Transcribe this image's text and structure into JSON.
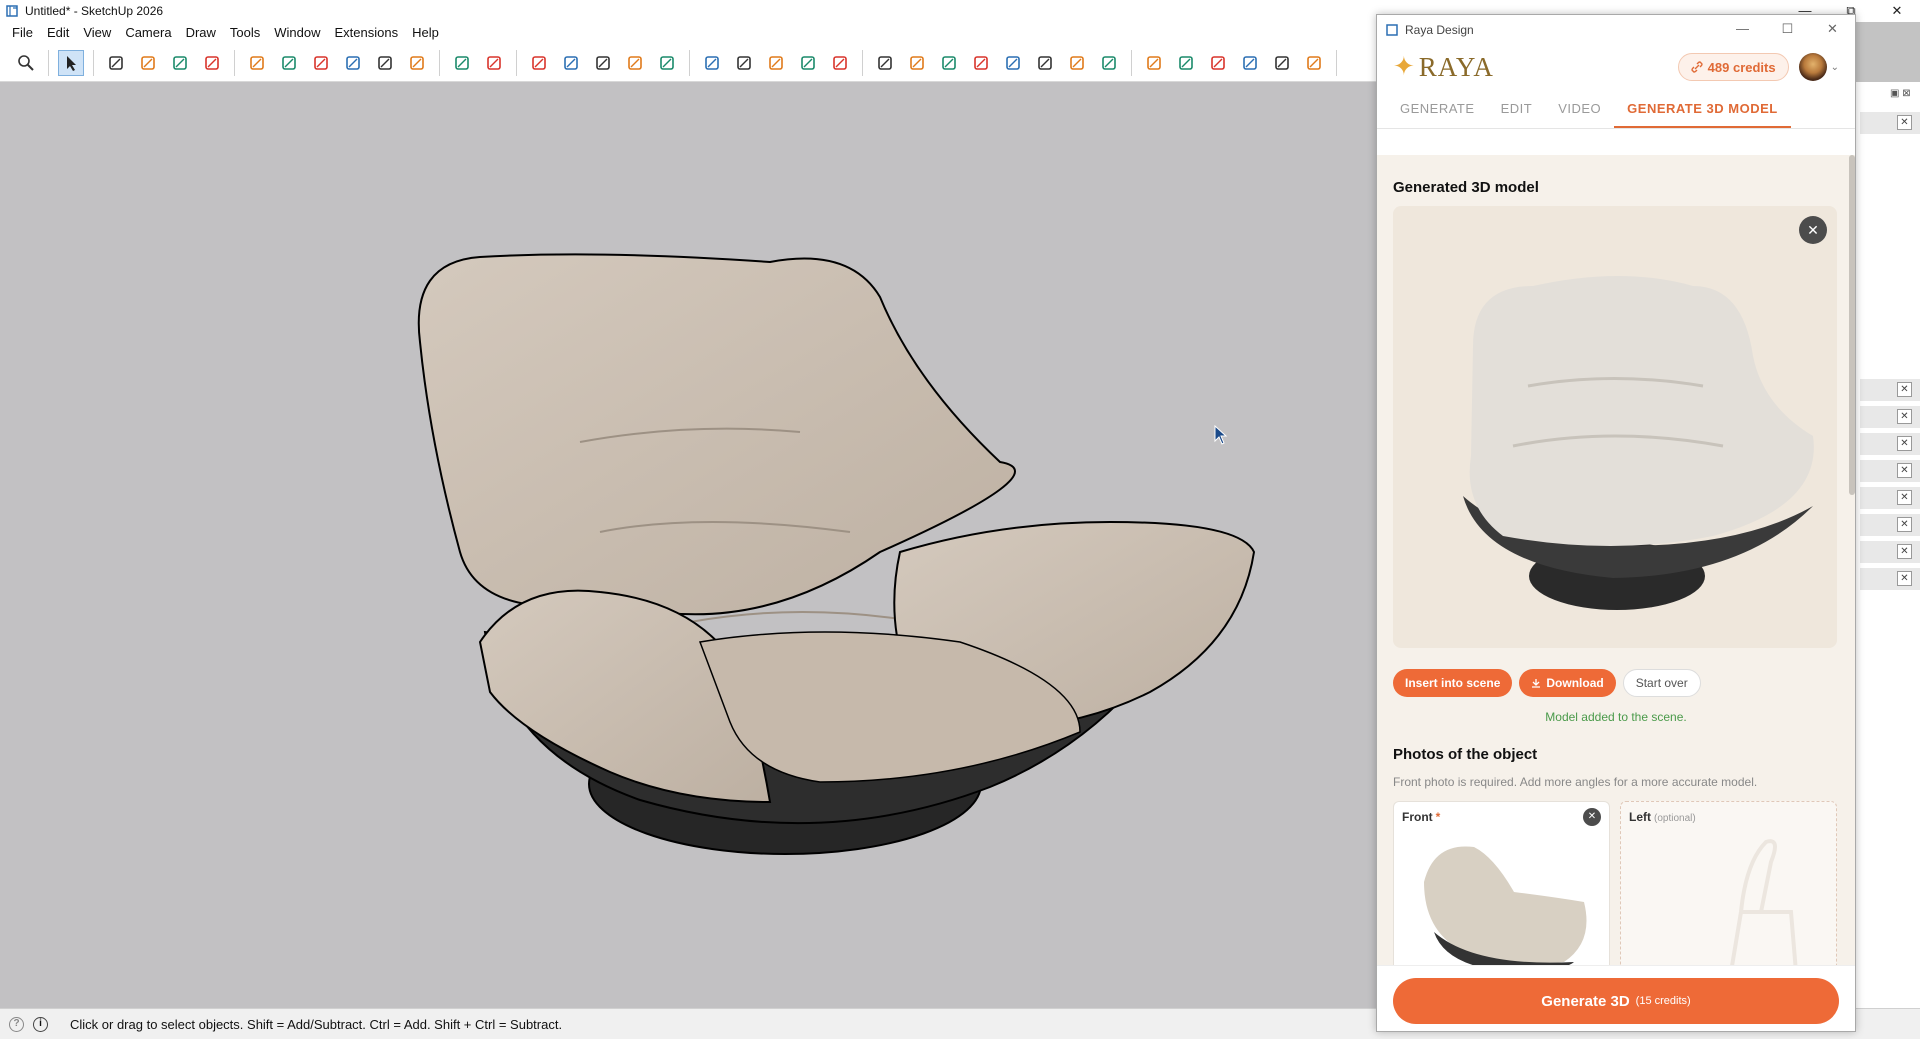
{
  "window": {
    "title": "Untitled* - SketchUp 2026",
    "controls": {
      "minimize": "—",
      "restore": "⧉",
      "close": "✕"
    }
  },
  "menu": [
    "File",
    "Edit",
    "View",
    "Camera",
    "Draw",
    "Tools",
    "Window",
    "Extensions",
    "Help"
  ],
  "toolbar": {
    "groups": [
      [
        "search-icon"
      ],
      [
        "select-icon"
      ],
      [
        "eraser-icon",
        "pencil-icon",
        "line-tool-icon",
        "rectangle-icon"
      ],
      [
        "push-pull-icon",
        "follow-me-icon",
        "move-icon",
        "rotate-icon",
        "scale-icon",
        "offset-icon"
      ],
      [
        "tape-measure-icon",
        "protractor-icon"
      ],
      [
        "section-plane-icon",
        "orbit-icon",
        "pan-icon",
        "zoom-icon",
        "zoom-extents-icon"
      ],
      [
        "component-icon",
        "materials-icon",
        "layers-icon",
        "3d-warehouse-icon",
        "user-icon"
      ],
      [
        "wireframe-icon",
        "hidden-line-icon",
        "xray-icon",
        "shaded-icon",
        "monochrome-icon",
        "textured-icon",
        "shaded-textures-icon",
        "back-edges-icon"
      ],
      [
        "iso-view-icon",
        "top-view-icon",
        "front-view-icon",
        "right-view-icon",
        "back-view-icon",
        "left-view-icon"
      ]
    ]
  },
  "status": {
    "text": "Click or drag to select objects. Shift = Add/Subtract. Ctrl = Add. Shift + Ctrl = Subtract."
  },
  "plugin": {
    "window_title": "Raya Design",
    "controls": {
      "minimize": "—",
      "maximize": "☐",
      "close": "✕"
    },
    "logo": "RAYA",
    "logo_star": "✦",
    "credits": "489 credits",
    "avatar_caret": "⌄",
    "tabs": [
      {
        "label": "GENERATE",
        "active": false
      },
      {
        "label": "EDIT",
        "active": false
      },
      {
        "label": "VIDEO",
        "active": false
      },
      {
        "label": "GENERATE 3D MODEL",
        "active": true
      }
    ],
    "section_title": "Generated 3D model",
    "close_glyph": "✕",
    "actions": {
      "insert": "Insert into scene",
      "download": "Download",
      "start_over": "Start over"
    },
    "added_message": "Model added to the scene.",
    "photos_title": "Photos of the object",
    "photos_hint": "Front photo is required. Add more angles for a more accurate model.",
    "front_label": "Front",
    "front_required": "*",
    "left_label": "Left",
    "left_optional": "(optional)",
    "generate_button": "Generate 3D",
    "generate_cost": "(15 credits)"
  },
  "colors": {
    "accent": "#ee6a37",
    "success": "#4a9a4a",
    "panel_bg": "#f6f1ea",
    "viewport_bg": "#c2c1c3"
  }
}
